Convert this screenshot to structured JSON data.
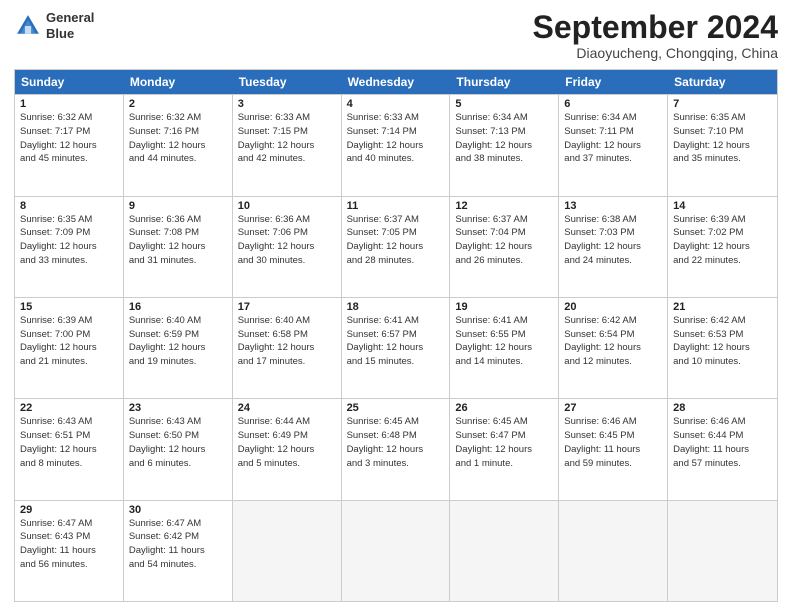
{
  "header": {
    "logo_line1": "General",
    "logo_line2": "Blue",
    "month": "September 2024",
    "location": "Diaoyucheng, Chongqing, China"
  },
  "days_of_week": [
    "Sunday",
    "Monday",
    "Tuesday",
    "Wednesday",
    "Thursday",
    "Friday",
    "Saturday"
  ],
  "weeks": [
    [
      {
        "day": "1",
        "info": "Sunrise: 6:32 AM\nSunset: 7:17 PM\nDaylight: 12 hours\nand 45 minutes."
      },
      {
        "day": "2",
        "info": "Sunrise: 6:32 AM\nSunset: 7:16 PM\nDaylight: 12 hours\nand 44 minutes."
      },
      {
        "day": "3",
        "info": "Sunrise: 6:33 AM\nSunset: 7:15 PM\nDaylight: 12 hours\nand 42 minutes."
      },
      {
        "day": "4",
        "info": "Sunrise: 6:33 AM\nSunset: 7:14 PM\nDaylight: 12 hours\nand 40 minutes."
      },
      {
        "day": "5",
        "info": "Sunrise: 6:34 AM\nSunset: 7:13 PM\nDaylight: 12 hours\nand 38 minutes."
      },
      {
        "day": "6",
        "info": "Sunrise: 6:34 AM\nSunset: 7:11 PM\nDaylight: 12 hours\nand 37 minutes."
      },
      {
        "day": "7",
        "info": "Sunrise: 6:35 AM\nSunset: 7:10 PM\nDaylight: 12 hours\nand 35 minutes."
      }
    ],
    [
      {
        "day": "8",
        "info": "Sunrise: 6:35 AM\nSunset: 7:09 PM\nDaylight: 12 hours\nand 33 minutes."
      },
      {
        "day": "9",
        "info": "Sunrise: 6:36 AM\nSunset: 7:08 PM\nDaylight: 12 hours\nand 31 minutes."
      },
      {
        "day": "10",
        "info": "Sunrise: 6:36 AM\nSunset: 7:06 PM\nDaylight: 12 hours\nand 30 minutes."
      },
      {
        "day": "11",
        "info": "Sunrise: 6:37 AM\nSunset: 7:05 PM\nDaylight: 12 hours\nand 28 minutes."
      },
      {
        "day": "12",
        "info": "Sunrise: 6:37 AM\nSunset: 7:04 PM\nDaylight: 12 hours\nand 26 minutes."
      },
      {
        "day": "13",
        "info": "Sunrise: 6:38 AM\nSunset: 7:03 PM\nDaylight: 12 hours\nand 24 minutes."
      },
      {
        "day": "14",
        "info": "Sunrise: 6:39 AM\nSunset: 7:02 PM\nDaylight: 12 hours\nand 22 minutes."
      }
    ],
    [
      {
        "day": "15",
        "info": "Sunrise: 6:39 AM\nSunset: 7:00 PM\nDaylight: 12 hours\nand 21 minutes."
      },
      {
        "day": "16",
        "info": "Sunrise: 6:40 AM\nSunset: 6:59 PM\nDaylight: 12 hours\nand 19 minutes."
      },
      {
        "day": "17",
        "info": "Sunrise: 6:40 AM\nSunset: 6:58 PM\nDaylight: 12 hours\nand 17 minutes."
      },
      {
        "day": "18",
        "info": "Sunrise: 6:41 AM\nSunset: 6:57 PM\nDaylight: 12 hours\nand 15 minutes."
      },
      {
        "day": "19",
        "info": "Sunrise: 6:41 AM\nSunset: 6:55 PM\nDaylight: 12 hours\nand 14 minutes."
      },
      {
        "day": "20",
        "info": "Sunrise: 6:42 AM\nSunset: 6:54 PM\nDaylight: 12 hours\nand 12 minutes."
      },
      {
        "day": "21",
        "info": "Sunrise: 6:42 AM\nSunset: 6:53 PM\nDaylight: 12 hours\nand 10 minutes."
      }
    ],
    [
      {
        "day": "22",
        "info": "Sunrise: 6:43 AM\nSunset: 6:51 PM\nDaylight: 12 hours\nand 8 minutes."
      },
      {
        "day": "23",
        "info": "Sunrise: 6:43 AM\nSunset: 6:50 PM\nDaylight: 12 hours\nand 6 minutes."
      },
      {
        "day": "24",
        "info": "Sunrise: 6:44 AM\nSunset: 6:49 PM\nDaylight: 12 hours\nand 5 minutes."
      },
      {
        "day": "25",
        "info": "Sunrise: 6:45 AM\nSunset: 6:48 PM\nDaylight: 12 hours\nand 3 minutes."
      },
      {
        "day": "26",
        "info": "Sunrise: 6:45 AM\nSunset: 6:47 PM\nDaylight: 12 hours\nand 1 minute."
      },
      {
        "day": "27",
        "info": "Sunrise: 6:46 AM\nSunset: 6:45 PM\nDaylight: 11 hours\nand 59 minutes."
      },
      {
        "day": "28",
        "info": "Sunrise: 6:46 AM\nSunset: 6:44 PM\nDaylight: 11 hours\nand 57 minutes."
      }
    ],
    [
      {
        "day": "29",
        "info": "Sunrise: 6:47 AM\nSunset: 6:43 PM\nDaylight: 11 hours\nand 56 minutes."
      },
      {
        "day": "30",
        "info": "Sunrise: 6:47 AM\nSunset: 6:42 PM\nDaylight: 11 hours\nand 54 minutes."
      },
      {
        "day": "",
        "info": ""
      },
      {
        "day": "",
        "info": ""
      },
      {
        "day": "",
        "info": ""
      },
      {
        "day": "",
        "info": ""
      },
      {
        "day": "",
        "info": ""
      }
    ]
  ]
}
